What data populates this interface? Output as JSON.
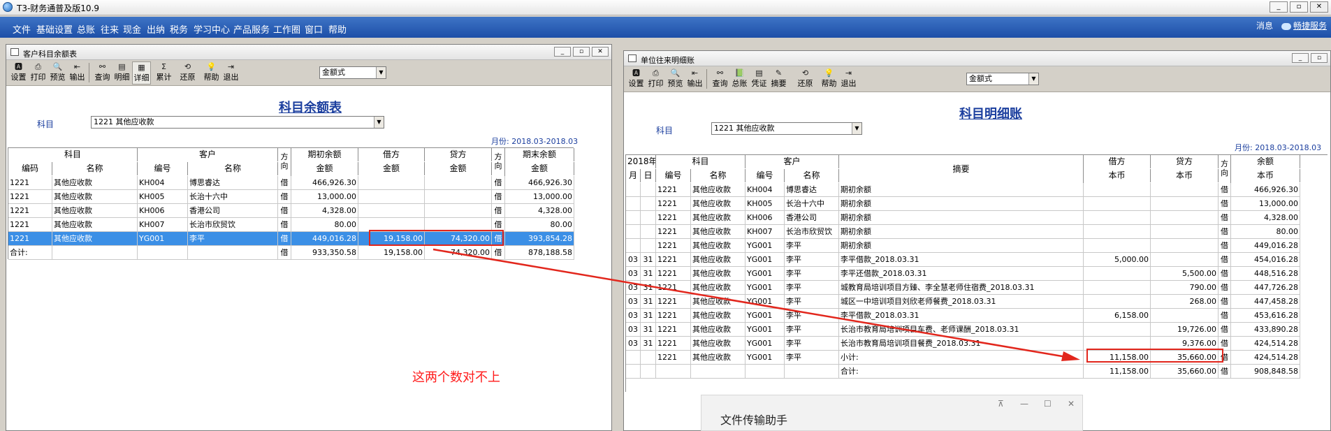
{
  "app": {
    "title": "T3-财务通普及版10.9"
  },
  "window_controls": {
    "minimize": "_",
    "restore": "▫",
    "close": "✕"
  },
  "menu": [
    "文件",
    "基础设置",
    "总账",
    "往来",
    "现金",
    "出纳",
    "税务",
    "学习中心",
    "产品服务",
    "工作圈",
    "窗口",
    "帮助"
  ],
  "menu_right": {
    "news": "消息",
    "service": "畅捷服务"
  },
  "left_win": {
    "title": "客户科目余额表",
    "toolbar": [
      "设置",
      "打印",
      "预览",
      "输出",
      "查询",
      "明细",
      "详细",
      "累计",
      "还原",
      "帮助",
      "退出"
    ],
    "format_combo": "金额式",
    "report_title": "科目余额表",
    "subject_label": "科目",
    "subject_value": "1221 其他应收款",
    "period": "月份: 2018.03-2018.03",
    "headers": {
      "group": [
        "科目",
        "客户",
        "方向",
        "期初余额",
        "借方",
        "贷方",
        "方向",
        "期末余额"
      ],
      "sub": [
        "编码",
        "名称",
        "编号",
        "名称",
        "金额",
        "金额",
        "金额",
        "金额"
      ]
    },
    "rows": [
      {
        "code": "1221",
        "name": "其他应收款",
        "cno": "KH004",
        "cname": "博思睿达",
        "dir": "借",
        "open": "466,926.30",
        "debit": "",
        "credit": "",
        "dir2": "借",
        "close": "466,926.30"
      },
      {
        "code": "1221",
        "name": "其他应收款",
        "cno": "KH005",
        "cname": "长治十六中",
        "dir": "借",
        "open": "13,000.00",
        "debit": "",
        "credit": "",
        "dir2": "借",
        "close": "13,000.00"
      },
      {
        "code": "1221",
        "name": "其他应收款",
        "cno": "KH006",
        "cname": "香港公司",
        "dir": "借",
        "open": "4,328.00",
        "debit": "",
        "credit": "",
        "dir2": "借",
        "close": "4,328.00"
      },
      {
        "code": "1221",
        "name": "其他应收款",
        "cno": "KH007",
        "cname": "长治市欣贸饮",
        "dir": "借",
        "open": "80.00",
        "debit": "",
        "credit": "",
        "dir2": "借",
        "close": "80.00"
      },
      {
        "code": "1221",
        "name": "其他应收款",
        "cno": "YG001",
        "cname": "李平",
        "dir": "借",
        "open": "449,016.28",
        "debit": "19,158.00",
        "credit": "74,320.00",
        "dir2": "借",
        "close": "393,854.28"
      },
      {
        "code": "合计:",
        "name": "",
        "cno": "",
        "cname": "",
        "dir": "借",
        "open": "933,350.58",
        "debit": "19,158.00",
        "credit": "74,320.00",
        "dir2": "借",
        "close": "878,188.58"
      }
    ]
  },
  "right_win": {
    "title": "单位往来明细账",
    "toolbar": [
      "设置",
      "打印",
      "预览",
      "输出",
      "查询",
      "总账",
      "凭证",
      "摘要",
      "还原",
      "帮助",
      "退出"
    ],
    "format_combo": "金额式",
    "report_title": "科目明细账",
    "subject_label": "科目",
    "subject_value": "1221 其他应收款",
    "period": "月份: 2018.03-2018.03",
    "headers": {
      "group": [
        "2018年",
        "科目",
        "客户",
        "摘要",
        "借方",
        "贷方",
        "方向",
        "余额"
      ],
      "sub": [
        "月",
        "日",
        "编号",
        "名称",
        "编号",
        "名称",
        "本币",
        "本币",
        "本币"
      ]
    },
    "rows": [
      {
        "m": "",
        "d": "",
        "code": "1221",
        "name": "其他应收款",
        "cno": "KH004",
        "cname": "博思睿达",
        "memo": "期初余额",
        "debit": "",
        "credit": "",
        "dir": "借",
        "bal": "466,926.30"
      },
      {
        "m": "",
        "d": "",
        "code": "1221",
        "name": "其他应收款",
        "cno": "KH005",
        "cname": "长治十六中",
        "memo": "期初余额",
        "debit": "",
        "credit": "",
        "dir": "借",
        "bal": "13,000.00"
      },
      {
        "m": "",
        "d": "",
        "code": "1221",
        "name": "其他应收款",
        "cno": "KH006",
        "cname": "香港公司",
        "memo": "期初余额",
        "debit": "",
        "credit": "",
        "dir": "借",
        "bal": "4,328.00"
      },
      {
        "m": "",
        "d": "",
        "code": "1221",
        "name": "其他应收款",
        "cno": "KH007",
        "cname": "长治市欣贸饮",
        "memo": "期初余额",
        "debit": "",
        "credit": "",
        "dir": "借",
        "bal": "80.00"
      },
      {
        "m": "",
        "d": "",
        "code": "1221",
        "name": "其他应收款",
        "cno": "YG001",
        "cname": "李平",
        "memo": "期初余额",
        "debit": "",
        "credit": "",
        "dir": "借",
        "bal": "449,016.28"
      },
      {
        "m": "03",
        "d": "31",
        "code": "1221",
        "name": "其他应收款",
        "cno": "YG001",
        "cname": "李平",
        "memo": "李平借款_2018.03.31",
        "debit": "5,000.00",
        "credit": "",
        "dir": "借",
        "bal": "454,016.28"
      },
      {
        "m": "03",
        "d": "31",
        "code": "1221",
        "name": "其他应收款",
        "cno": "YG001",
        "cname": "李平",
        "memo": "李平还借款_2018.03.31",
        "debit": "",
        "credit": "5,500.00",
        "dir": "借",
        "bal": "448,516.28"
      },
      {
        "m": "03",
        "d": "31",
        "code": "1221",
        "name": "其他应收款",
        "cno": "YG001",
        "cname": "李平",
        "memo": "城教育局培训项目方臻、李全慧老师住宿费_2018.03.31",
        "debit": "",
        "credit": "790.00",
        "dir": "借",
        "bal": "447,726.28"
      },
      {
        "m": "03",
        "d": "31",
        "code": "1221",
        "name": "其他应收款",
        "cno": "YG001",
        "cname": "李平",
        "memo": "城区一中培训项目刘欣老师餐费_2018.03.31",
        "debit": "",
        "credit": "268.00",
        "dir": "借",
        "bal": "447,458.28"
      },
      {
        "m": "03",
        "d": "31",
        "code": "1221",
        "name": "其他应收款",
        "cno": "YG001",
        "cname": "李平",
        "memo": "李平借款_2018.03.31",
        "debit": "6,158.00",
        "credit": "",
        "dir": "借",
        "bal": "453,616.28"
      },
      {
        "m": "03",
        "d": "31",
        "code": "1221",
        "name": "其他应收款",
        "cno": "YG001",
        "cname": "李平",
        "memo": "长治市教育局培训项目车费、老师课酬_2018.03.31",
        "debit": "",
        "credit": "19,726.00",
        "dir": "借",
        "bal": "433,890.28"
      },
      {
        "m": "03",
        "d": "31",
        "code": "1221",
        "name": "其他应收款",
        "cno": "YG001",
        "cname": "李平",
        "memo": "长治市教育局培训项目餐费_2018.03.31",
        "debit": "",
        "credit": "9,376.00",
        "dir": "借",
        "bal": "424,514.28"
      },
      {
        "m": "",
        "d": "",
        "code": "1221",
        "name": "其他应收款",
        "cno": "YG001",
        "cname": "李平",
        "memo": "小计:",
        "debit": "11,158.00",
        "credit": "35,660.00",
        "dir": "借",
        "bal": "424,514.28"
      },
      {
        "m": "",
        "d": "",
        "code": "",
        "name": "",
        "cno": "",
        "cname": "",
        "memo": "合计:",
        "debit": "11,158.00",
        "credit": "35,660.00",
        "dir": "借",
        "bal": "908,848.58"
      }
    ]
  },
  "annotation": {
    "text": "这两个数对不上",
    "color": "#ff1a1a"
  },
  "popup": {
    "title": "文件传输助手",
    "pin": "⊼",
    "min": "—",
    "max": "☐",
    "close": "✕"
  },
  "colors": {
    "menubar": "#2a5db5",
    "report_text": "#1b3e9e",
    "selection": "#3b8fe6",
    "highlight": "#e2261c"
  }
}
